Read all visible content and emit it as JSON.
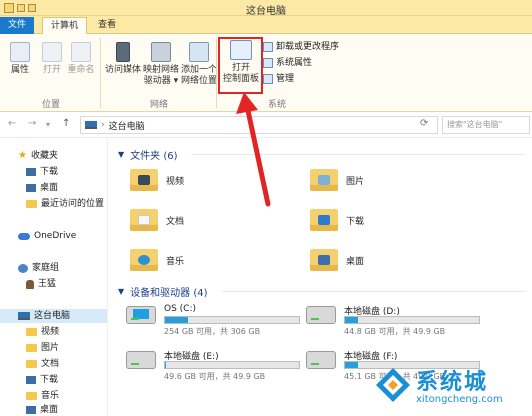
{
  "window": {
    "title": "这台电脑"
  },
  "tabs": [
    {
      "label": "文件"
    },
    {
      "label": "计算机"
    },
    {
      "label": "查看"
    }
  ],
  "ribbon": {
    "location_group": {
      "label": "位置",
      "items": [
        {
          "label": "属性"
        },
        {
          "label": "打开"
        },
        {
          "label": "重命名"
        }
      ]
    },
    "network_group": {
      "label": "网络",
      "items": [
        {
          "label": "访问媒体"
        },
        {
          "label_1": "映射网络",
          "label_2": "驱动器 ▾"
        },
        {
          "label_1": "添加一个",
          "label_2": "网络位置"
        }
      ]
    },
    "system_group": {
      "label": "系统",
      "control_panel": {
        "label_1": "打开",
        "label_2": "控制面板"
      },
      "items": [
        {
          "label": "卸载或更改程序"
        },
        {
          "label": "系统属性"
        },
        {
          "label": "管理"
        }
      ]
    }
  },
  "address_bar": {
    "crumb": "这台电脑",
    "search_placeholder": "搜索\"这台电脑\""
  },
  "nav_pane": {
    "favorites": "收藏夹",
    "favorites_items": [
      "下载",
      "桌面",
      "最近访问的位置"
    ],
    "onedrive": "OneDrive",
    "homegroup": "家庭组",
    "homegroup_user": "王猛",
    "this_pc": "这台电脑",
    "this_pc_items": [
      "视频",
      "图片",
      "文档",
      "下载",
      "音乐",
      "桌面"
    ]
  },
  "folders_section": {
    "header": "文件夹 (6)",
    "items": [
      {
        "label": "视频"
      },
      {
        "label": "图片"
      },
      {
        "label": "文档"
      },
      {
        "label": "下载"
      },
      {
        "label": "音乐"
      },
      {
        "label": "桌面"
      }
    ]
  },
  "drives_section": {
    "header": "设备和驱动器 (4)",
    "items": [
      {
        "name": "OS (C:)",
        "info": "254 GB 可用，共 306 GB",
        "used_fraction": 0.17
      },
      {
        "name": "本地磁盘 (D:)",
        "info": "44.8 GB 可用，共 49.9 GB",
        "used_fraction": 0.1
      },
      {
        "name": "本地磁盘 (E:)",
        "info": "49.6 GB 可用，共 49.9 GB",
        "used_fraction": 0.01
      },
      {
        "name": "本地磁盘 (F:)",
        "info": "45.1 GB 可用，共 49.9 GB",
        "used_fraction": 0.1
      }
    ]
  },
  "watermark": {
    "brand": "系统城",
    "url": "xitongcheng.com"
  },
  "colors": {
    "ribbon_bg": "#fffdf3",
    "title_bg": "#fbe9a5",
    "file_tab": "#1979ca",
    "highlight": "#e32424",
    "drive_fill": "#26a0da",
    "section_text": "#1e3f8a"
  }
}
